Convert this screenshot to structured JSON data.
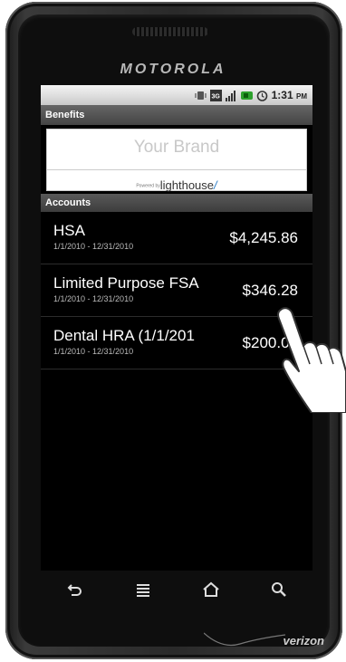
{
  "device": {
    "manufacturer": "MOTOROLA",
    "carrier": "verizon"
  },
  "status_bar": {
    "time": "1:31",
    "ampm": "PM",
    "icons": [
      "vibrate-icon",
      "3g-icon",
      "signal-icon",
      "battery-icon",
      "alarm-icon"
    ]
  },
  "app": {
    "title": "Benefits",
    "brand_placeholder": "Your Brand",
    "powered_by": "Powered by",
    "powered_brand": "lighthouse"
  },
  "accounts": {
    "header": "Accounts",
    "items": [
      {
        "name": "HSA",
        "dates": "1/1/2010 - 12/31/2010",
        "balance": "$4,245.86"
      },
      {
        "name": "Limited Purpose FSA",
        "dates": "1/1/2010 - 12/31/2010",
        "balance": "$346.28"
      },
      {
        "name": "Dental HRA (1/1/201",
        "dates": "1/1/2010 - 12/31/2010",
        "balance": "$200.00"
      }
    ]
  },
  "nav": {
    "buttons": [
      "back-icon",
      "menu-icon",
      "home-icon",
      "search-icon"
    ]
  },
  "colors": {
    "screen_bg": "#000000",
    "title_bar": "#555555",
    "powered_accent": "#2a7cc7"
  }
}
